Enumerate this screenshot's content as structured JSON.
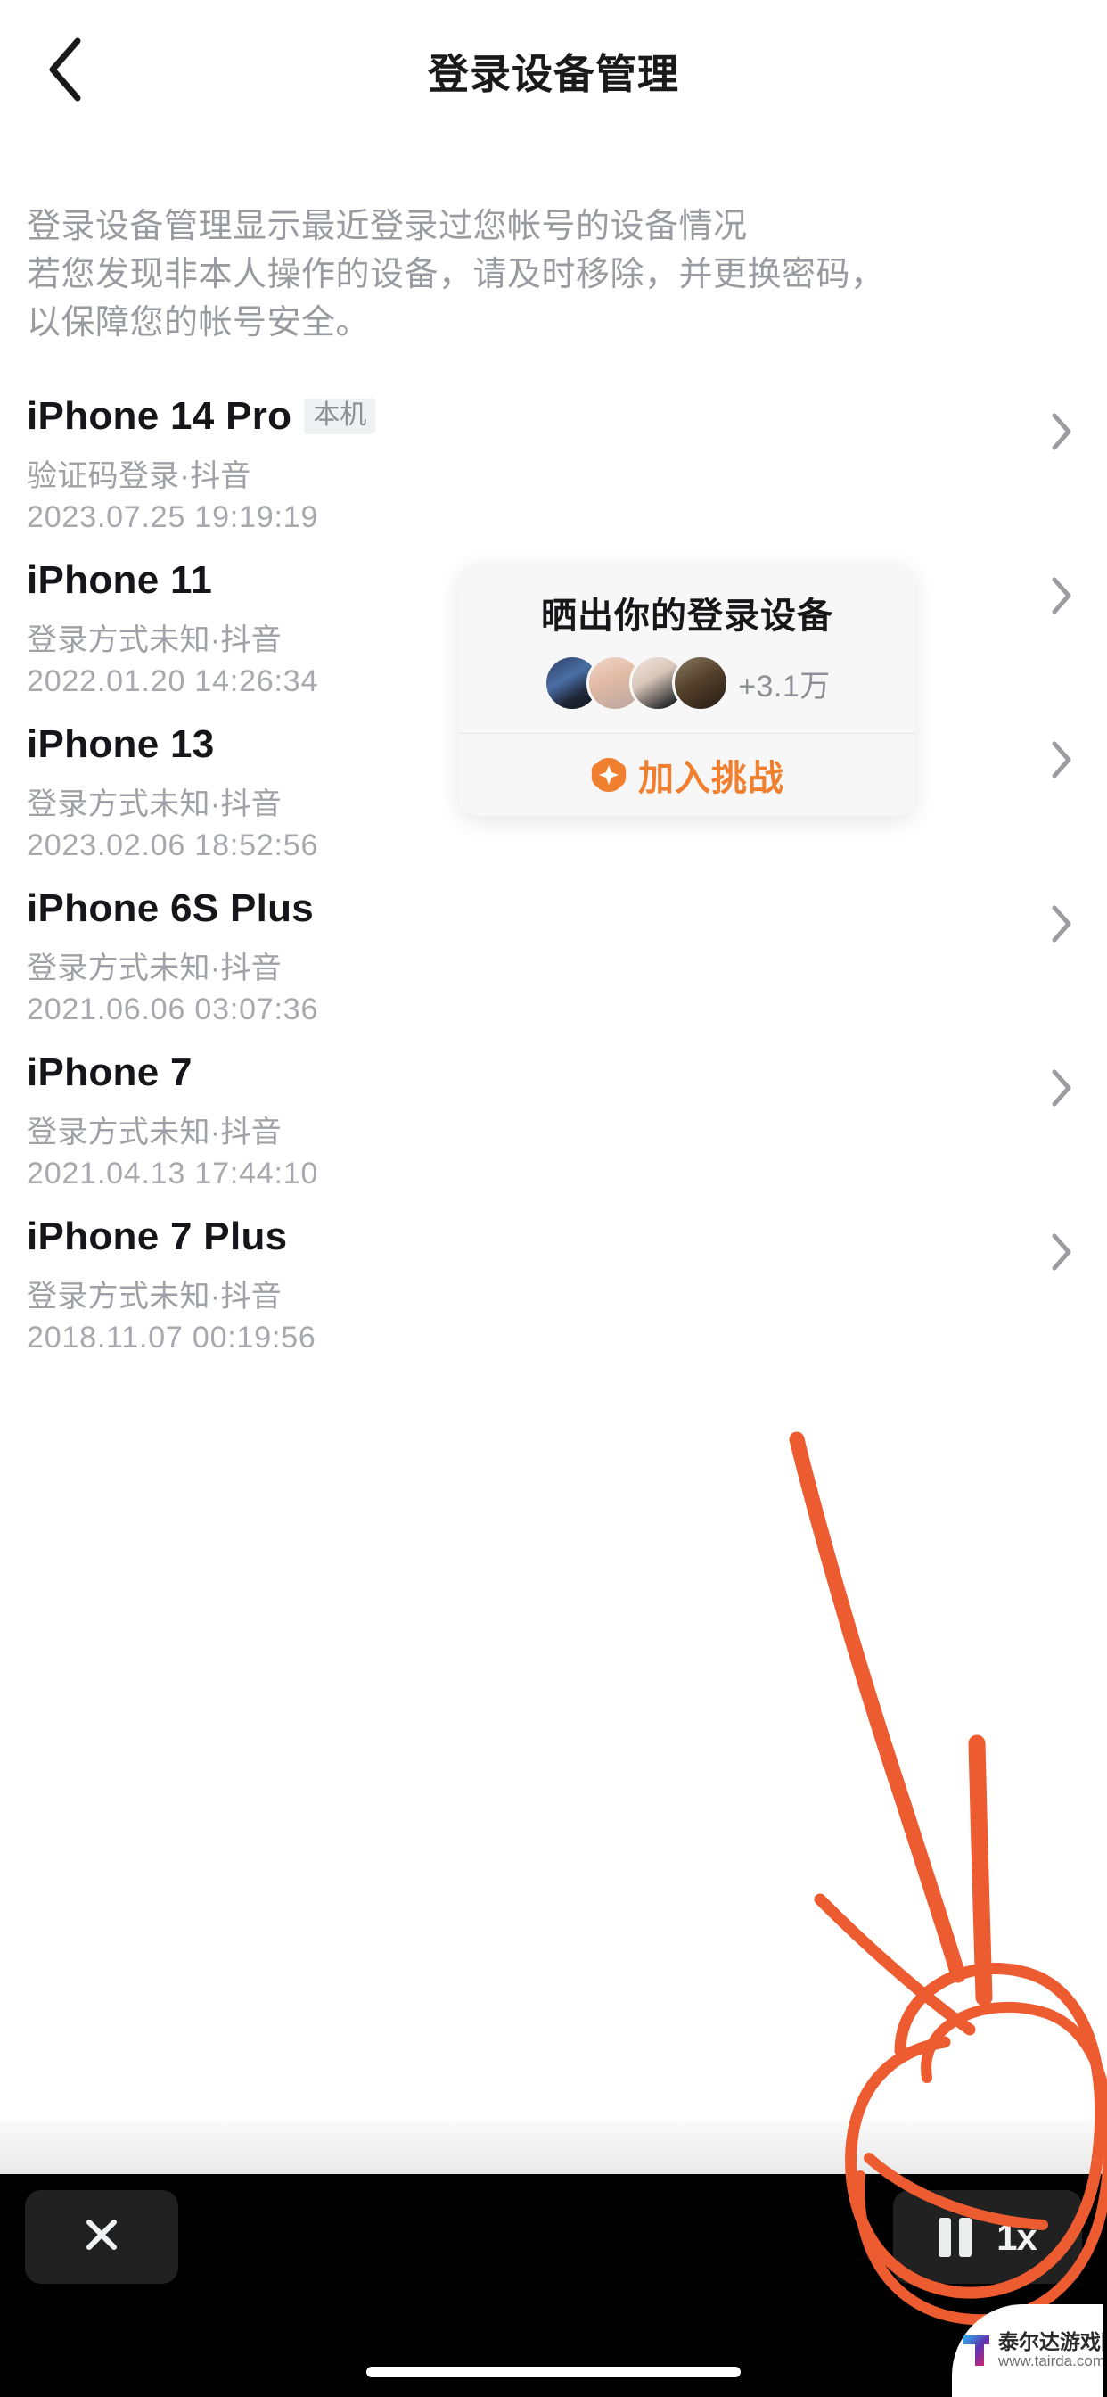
{
  "header": {
    "title": "登录设备管理",
    "back_icon": "chevron-left-icon"
  },
  "description": {
    "line1": "登录设备管理显示最近登录过您帐号的设备情况",
    "line2": "若您发现非本人操作的设备，请及时移除，并更换密码，",
    "line3": "以保障您的帐号安全。"
  },
  "devices": [
    {
      "name": "iPhone 14 Pro",
      "badge": "本机",
      "login_method": "验证码登录·抖音",
      "timestamp": "2023.07.25 19:19:19"
    },
    {
      "name": "iPhone 11",
      "badge": "",
      "login_method": "登录方式未知·抖音",
      "timestamp": "2022.01.20 14:26:34"
    },
    {
      "name": "iPhone 13",
      "badge": "",
      "login_method": "登录方式未知·抖音",
      "timestamp": "2023.02.06 18:52:56"
    },
    {
      "name": "iPhone 6S Plus",
      "badge": "",
      "login_method": "登录方式未知·抖音",
      "timestamp": "2021.06.06 03:07:36"
    },
    {
      "name": "iPhone 7",
      "badge": "",
      "login_method": "登录方式未知·抖音",
      "timestamp": "2021.04.13 17:44:10"
    },
    {
      "name": "iPhone 7 Plus",
      "badge": "",
      "login_method": "登录方式未知·抖音",
      "timestamp": "2018.11.07 00:19:56"
    }
  ],
  "challenge_card": {
    "title": "晒出你的登录设备",
    "participant_count": "+3.1万",
    "join_label": "加入挑战",
    "join_icon": "plus-sparkle-icon",
    "accent_color": "#f08030",
    "avatars": [
      "avatar-1",
      "avatar-2",
      "avatar-3",
      "avatar-4"
    ]
  },
  "bottom_bar": {
    "close_icon": "close-icon",
    "pause_icon": "pause-icon",
    "speed_label": "1x"
  },
  "annotation": {
    "color": "#ed5b31",
    "shapes": [
      "arrow-stroke",
      "tick-stroke",
      "circle-highlight"
    ]
  },
  "watermark": {
    "site_name": "泰尔达游戏网",
    "url": "www.tairda.com",
    "logo_icon": "tairda-t-logo-icon"
  }
}
